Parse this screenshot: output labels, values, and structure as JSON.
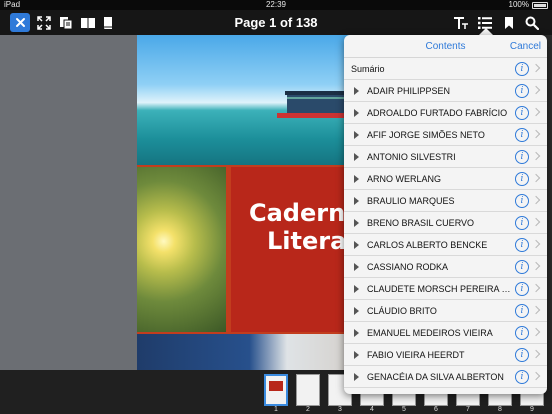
{
  "status_bar": {
    "device": "iPad",
    "time": "22:39",
    "battery": "100%"
  },
  "toolbar": {
    "page_title": "Page 1 of 138",
    "left_icons": [
      "close-icon",
      "fit-screen-icon",
      "copy-pages-icon",
      "reading-mode-icon",
      "book-icon"
    ],
    "right_icons": [
      "text-size-icon",
      "contents-list-icon",
      "bookmark-icon",
      "search-icon"
    ],
    "accent": "#2f7ad9"
  },
  "cover": {
    "line1": "Caderno",
    "line2": "Literat"
  },
  "contents": {
    "title": "Contents",
    "cancel_label": "Cancel",
    "items": [
      {
        "label": "Sumário",
        "expandable": false
      },
      {
        "label": "ADAIR PHILIPPSEN",
        "expandable": true
      },
      {
        "label": "ADROALDO FURTADO FABRÍCIO",
        "expandable": true
      },
      {
        "label": "AFIF JORGE SIMÕES NETO",
        "expandable": true
      },
      {
        "label": "ANTONIO SILVESTRI",
        "expandable": true
      },
      {
        "label": "ARNO WERLANG",
        "expandable": true
      },
      {
        "label": "BRAULIO MARQUES",
        "expandable": true
      },
      {
        "label": "BRENO BRASIL CUERVO",
        "expandable": true
      },
      {
        "label": "CARLOS ALBERTO BENCKE",
        "expandable": true
      },
      {
        "label": "CASSIANO RODKA",
        "expandable": true
      },
      {
        "label": "CLAUDETE MORSCH PEREIRA S...",
        "expandable": true
      },
      {
        "label": "CLÁUDIO BRITO",
        "expandable": true
      },
      {
        "label": "EMANUEL MEDEIROS VIEIRA",
        "expandable": true
      },
      {
        "label": "FABIO VIEIRA HEERDT",
        "expandable": true
      },
      {
        "label": "GENACÉIA DA SILVA ALBERTON",
        "expandable": true
      }
    ]
  },
  "thumbnails": {
    "current_page": 1,
    "pages": [
      "1",
      "2",
      "3",
      "4",
      "5",
      "6",
      "7",
      "8",
      "9"
    ]
  }
}
